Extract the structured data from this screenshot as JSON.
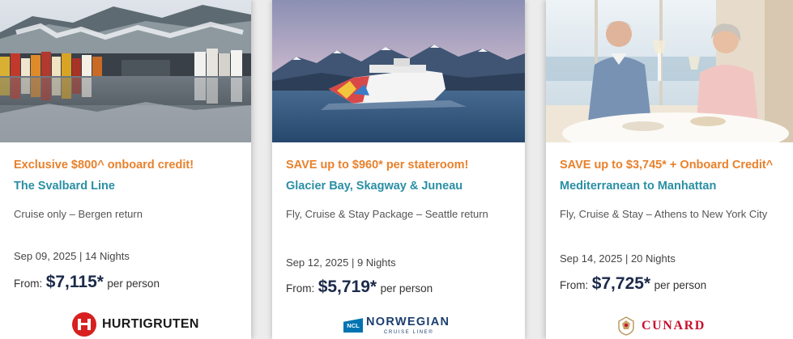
{
  "cards": [
    {
      "promo": "Exclusive $800^ onboard credit!",
      "route": "The Svalbard Line",
      "package": "Cruise only – Bergen return",
      "dates": "Sep 09, 2025 | 14 Nights",
      "price_prefix": "From:",
      "price": "$7,115*",
      "price_suffix": "per person",
      "logo_text": "HURTIGRUTEN"
    },
    {
      "promo": "SAVE up to $960* per stateroom!",
      "route": "Glacier Bay, Skagway & Juneau",
      "package": "Fly, Cruise & Stay Package – Seattle return",
      "dates": "Sep 12, 2025 | 9 Nights",
      "price_prefix": "From:",
      "price": "$5,719*",
      "price_suffix": "per person",
      "logo_mark": "NCL",
      "logo_text": "NORWEGIAN",
      "logo_subtext": "CRUISE LINE®"
    },
    {
      "promo": "SAVE up to $3,745* + Onboard Credit^",
      "route": "Mediterranean to Manhattan",
      "package": "Fly, Cruise & Stay – Athens to New York City",
      "dates": "Sep 14, 2025 | 20 Nights",
      "price_prefix": "From:",
      "price": "$7,725*",
      "price_suffix": "per person",
      "logo_text": "CUNARD"
    }
  ],
  "colors": {
    "promo": "#e8812c",
    "route": "#2a8fa4",
    "price": "#1c2a4a",
    "hurtigruten_red": "#d7201f",
    "ncl_blue": "#0073b1",
    "cunard_red": "#c8102e"
  },
  "icons": [
    "hurtigruten-logo-icon",
    "ncl-logo-icon",
    "cunard-crest-icon"
  ]
}
